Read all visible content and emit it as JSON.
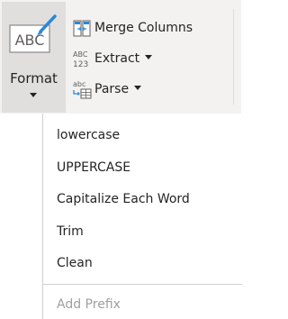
{
  "ribbon": {
    "format": {
      "label": "Format",
      "icon": "abc-text-icon"
    },
    "items": [
      {
        "label": "Merge Columns",
        "icon": "merge-columns-icon"
      },
      {
        "label": "Extract",
        "icon_text_top": "ABC",
        "icon_text_bottom": "123",
        "icon": "extract-icon"
      },
      {
        "label": "Parse",
        "icon_text": "abc",
        "icon": "parse-icon"
      }
    ]
  },
  "menu": {
    "items": [
      {
        "label": "lowercase"
      },
      {
        "label": "UPPERCASE"
      },
      {
        "label": "Capitalize Each Word"
      },
      {
        "label": "Trim"
      },
      {
        "label": "Clean"
      },
      {
        "label": "Add Prefix",
        "disabled": true
      }
    ]
  },
  "colors": {
    "ribbon_bg": "#f3f2f1",
    "pressed_bg": "#e1dfdd",
    "icon_blue": "#2b88d8",
    "text": "#252423",
    "disabled_text": "#a19f9d"
  }
}
